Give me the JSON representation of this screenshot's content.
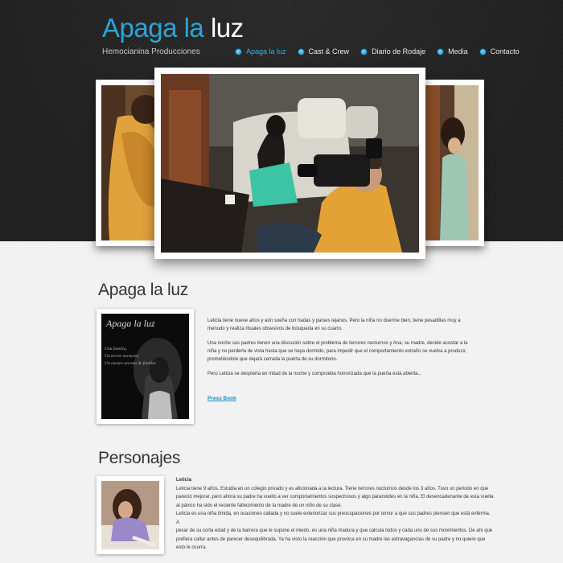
{
  "header": {
    "logo_part1": "Apaga la",
    "logo_part2": "luz",
    "tagline": "Hemocianina Producciones",
    "accent_color": "#2ea3d6",
    "nav": [
      {
        "label": "Apaga la luz",
        "active": true
      },
      {
        "label": "Cast & Crew",
        "active": false
      },
      {
        "label": "Diario de Rodaje",
        "active": false
      },
      {
        "label": "Media",
        "active": false
      },
      {
        "label": "Contacto",
        "active": false
      }
    ]
  },
  "about": {
    "title": "Apaga la luz",
    "poster_title": "Apaga la luz",
    "poster_lines": [
      "Una familia,",
      "Un terror nocturno,",
      "Un oscuro secreto de familia"
    ],
    "paragraphs": [
      "Leticia tiene nueve años y aún sueña con hadas y países lejanos. Pero la niña no duerme bien, tiene pesadillas muy a menudo y realiza rituales obsesivos de búsqueda en su cuarto.",
      "Una noche sus padres tienen una discusión sobre el problema de terrores nocturnos y Ana, su madre, decide acostar a la niña y no perderla de vista hasta que se haya dormido, para impedir que el comportamiento extraño se vuelva a producir, prometiéndole que dejará cerrada la puerta de su dormitorio.",
      "Pero Leticia se despierta en mitad de la noche y comprueba horrorizada que la puerta está abierta..."
    ],
    "press_link": "Press Book"
  },
  "characters": {
    "title": "Personajes",
    "items": [
      {
        "name": "Leticia",
        "lines": [
          "Leticia tiene 9 años. Estudia en un colegio privado y es aficionada a la lectura. Tiene terrores nocturnos desde los 3 años. Tuvo un periodo en que",
          "pareció mejorar, pero ahora su padre ha vuelto a ver comportamientos sospechosos y algo paranoides en la niña. El desencadenante de esta vuelta",
          "al pánico ha sido el reciente fallecimiento de la madre de un niño de su clase.",
          "Leticia es una niña tímida, en ocasiones callada y no suele exteriorizar sus preocupaciones por temor a que sus padres piensen que está enferma. A",
          "pesar de su corta edad y de la barrera que le supone el miedo, es una niña madura y que calcula todos y cada uno de sus movimientos. De ahí que",
          "prefiera callar antes de parecer desequilibrada. Ya ha visto la reacción que provoca en su madre las extravagancias de su padre y no quiere que",
          "esto le ocurra."
        ]
      }
    ]
  }
}
